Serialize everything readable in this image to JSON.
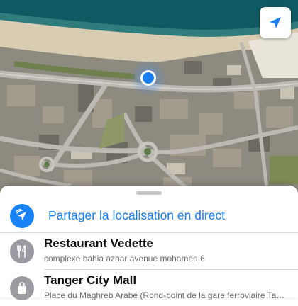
{
  "map": {
    "type": "satellite",
    "colors": {
      "sea": "#0e5a63",
      "beach": "#d8cdb3",
      "road": "#b8b6b0",
      "accent": "#1a82f7"
    },
    "locate_icon": "navigation-arrow-icon",
    "user_marker": "user-location-dot"
  },
  "sheet": {
    "share": {
      "icon": "share-location-icon",
      "label": "Partager la localisation en direct"
    },
    "places": [
      {
        "icon": "fork-knife-icon",
        "name": "Restaurant Vedette",
        "address": "complexe bahia azhar avenue mohamed 6"
      },
      {
        "icon": "shopping-bag-icon",
        "name": "Tanger City Mall",
        "address": "Place du Maghreb Arabe  (Rond-point de la gare ferroviaire Ta…"
      }
    ]
  }
}
